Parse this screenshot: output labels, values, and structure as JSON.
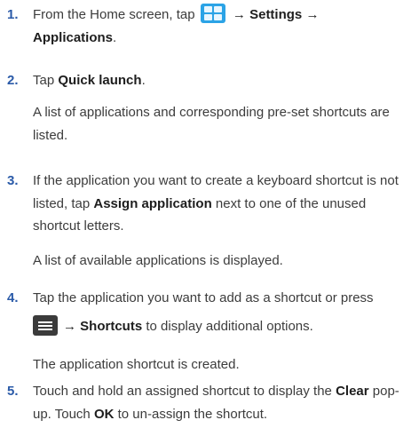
{
  "steps": [
    {
      "number": "1.",
      "line1_pre": "From the Home screen, tap",
      "arrow1": "→",
      "settings": "Settings",
      "arrow2": "→",
      "applications": "Applications",
      "period": "."
    },
    {
      "number": "2.",
      "pre": "Tap ",
      "bold": "Quick launch",
      "post": ".",
      "note": "A list of applications and corresponding pre-set shortcuts are listed."
    },
    {
      "number": "3.",
      "pre": "If the application you want to create a keyboard shortcut is not listed, tap ",
      "bold": "Assign application",
      "post": " next to one of the unused shortcut letters.",
      "note": "A list of available applications is displayed."
    },
    {
      "number": "4.",
      "line1": "Tap the application you want to add as a shortcut or press",
      "arrow": "→",
      "bold": "Shortcuts",
      "post": " to display additional options.",
      "note": "The application shortcut is created."
    },
    {
      "number": "5.",
      "pre": "Touch and hold an assigned shortcut to display the ",
      "bold1": "Clear",
      "mid": " pop-up. Touch ",
      "bold2": "OK",
      "post": " to un-assign the shortcut."
    }
  ],
  "icons": {
    "applications_icon": "apps-grid-icon",
    "menu_icon": "menu-key-icon",
    "applications_icon_color": "#2ba3e6",
    "menu_icon_color": "#3b3b3b",
    "step_number_color": "#2a5aa8"
  }
}
